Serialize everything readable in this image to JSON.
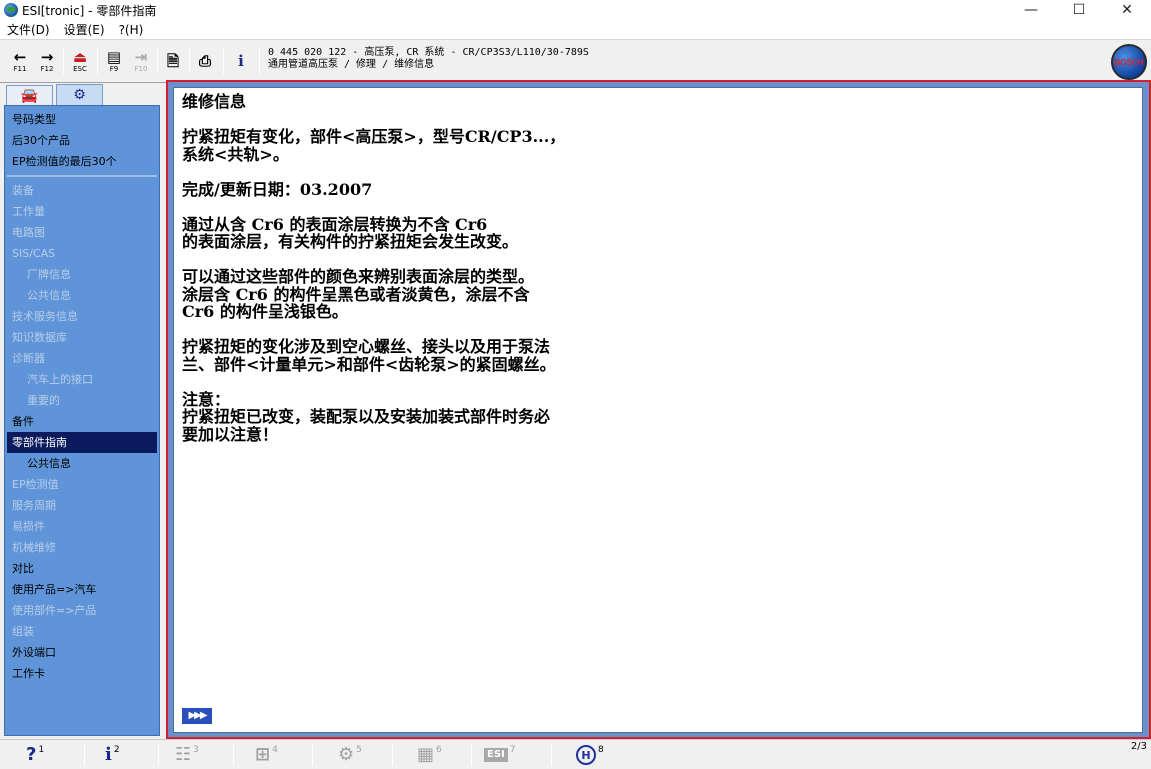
{
  "window": {
    "title": "ESI[tronic] - 零部件指南",
    "controls": {
      "minimize": "—",
      "maximize": "☐",
      "close": "✕"
    }
  },
  "menu": {
    "items": [
      "文件(D)",
      "设置(E)",
      "?(H)"
    ]
  },
  "toolbar": {
    "buttons": [
      {
        "icon": "back-arrow-icon",
        "glyph": "←",
        "key": "F11"
      },
      {
        "icon": "forward-arrow-icon",
        "glyph": "→",
        "key": "F12"
      },
      {
        "icon": "exit-icon",
        "glyph": "⏏",
        "key": "ESC"
      },
      {
        "icon": "book-icon",
        "glyph": "▤",
        "key": "F9"
      },
      {
        "icon": "split-view-icon",
        "glyph": "⇥",
        "key": "F10"
      },
      {
        "icon": "document-icon",
        "glyph": "🗎",
        "key": ""
      },
      {
        "icon": "printer-icon",
        "glyph": "⎙",
        "key": ""
      },
      {
        "icon": "info-icon",
        "glyph": "i",
        "key": ""
      }
    ],
    "breadcrumb_line1": "0 445 020 122 - 高压泵, CR 系统 - CR/CP3S3/L110/30-789S",
    "breadcrumb_line2": "通用管道高压泵 / 修理 / 维修信息",
    "logo_text": "BOSCH"
  },
  "sidebar": {
    "tabs": [
      {
        "icon": "car-icon",
        "glyph": "🚘"
      },
      {
        "icon": "engine-icon",
        "glyph": "⚙"
      }
    ],
    "items": [
      {
        "label": "号码类型",
        "state": "active"
      },
      {
        "label": "后30个产品",
        "state": "active"
      },
      {
        "label": "EP检测值的最后30个",
        "state": "active"
      },
      {
        "label": "装备",
        "state": "disabled"
      },
      {
        "label": "工作量",
        "state": "disabled"
      },
      {
        "label": "电路图",
        "state": "disabled"
      },
      {
        "label": "SIS/CAS",
        "state": "disabled"
      },
      {
        "label": "厂牌信息",
        "state": "disabled"
      },
      {
        "label": "公共信息",
        "state": "disabled"
      },
      {
        "label": "技术服务信息",
        "state": "disabled"
      },
      {
        "label": "知识数据库",
        "state": "disabled"
      },
      {
        "label": "诊断器",
        "state": "disabled"
      },
      {
        "label": "汽车上的接口",
        "state": "disabled"
      },
      {
        "label": "重要的",
        "state": "disabled"
      },
      {
        "label": "备件",
        "state": "active"
      },
      {
        "label": "零部件指南",
        "state": "selected"
      },
      {
        "label": "公共信息",
        "state": "active"
      },
      {
        "label": "EP检测值",
        "state": "disabled"
      },
      {
        "label": "服务周期",
        "state": "disabled"
      },
      {
        "label": "易损件",
        "state": "disabled"
      },
      {
        "label": "机械维修",
        "state": "disabled"
      },
      {
        "label": "对比",
        "state": "active"
      },
      {
        "label": "使用产品=>汽车",
        "state": "active"
      },
      {
        "label": "使用部件=>产品",
        "state": "disabled"
      },
      {
        "label": "组装",
        "state": "disabled"
      },
      {
        "label": "外设端口",
        "state": "active"
      },
      {
        "label": "工作卡",
        "state": "active"
      }
    ]
  },
  "content": {
    "heading": "维修信息",
    "paragraphs": [
      "拧紧扭矩有变化，部件<高压泵>，型号CR/CP3...，\n系统<共轨>。",
      "完成/更新日期：03.2007",
      "通过从含 Cr6 的表面涂层转换为不含 Cr6\n的表面涂层，有关构件的拧紧扭矩会发生改变。",
      "可以通过这些部件的颜色来辨别表面涂层的类型。\n涂层含 Cr6 的构件呈黑色或者淡黄色，涂层不含\nCr6 的构件呈浅银色。",
      "拧紧扭矩的变化涉及到空心螺丝、接头以及用于泵法\n兰、部件<计量单元>和部件<齿轮泵>的紧固螺丝。",
      "注意：\n拧紧扭矩已改变，装配泵以及安装加装式部件时务必\n要加以注意！"
    ],
    "more_glyph": "▶▶▶"
  },
  "funcbar": {
    "buttons": [
      {
        "icon": "help-icon",
        "glyph": "?",
        "num": "1",
        "state": "active"
      },
      {
        "icon": "info-icon",
        "glyph": "i",
        "num": "2",
        "state": "active"
      },
      {
        "icon": "list-icon",
        "glyph": "☷",
        "num": "3",
        "state": "disabled"
      },
      {
        "icon": "diagram-icon",
        "glyph": "⊞",
        "num": "4",
        "state": "disabled"
      },
      {
        "icon": "engine-tool-icon",
        "glyph": "⚙",
        "num": "5",
        "state": "disabled"
      },
      {
        "icon": "sheet-icon",
        "glyph": "▦",
        "num": "6",
        "state": "disabled"
      },
      {
        "icon": "esi-icon",
        "glyph": "ESI",
        "num": "7",
        "state": "disabled"
      },
      {
        "icon": "bosch-icon",
        "glyph": "H",
        "num": "8",
        "state": "active"
      }
    ],
    "page": "2/3"
  }
}
